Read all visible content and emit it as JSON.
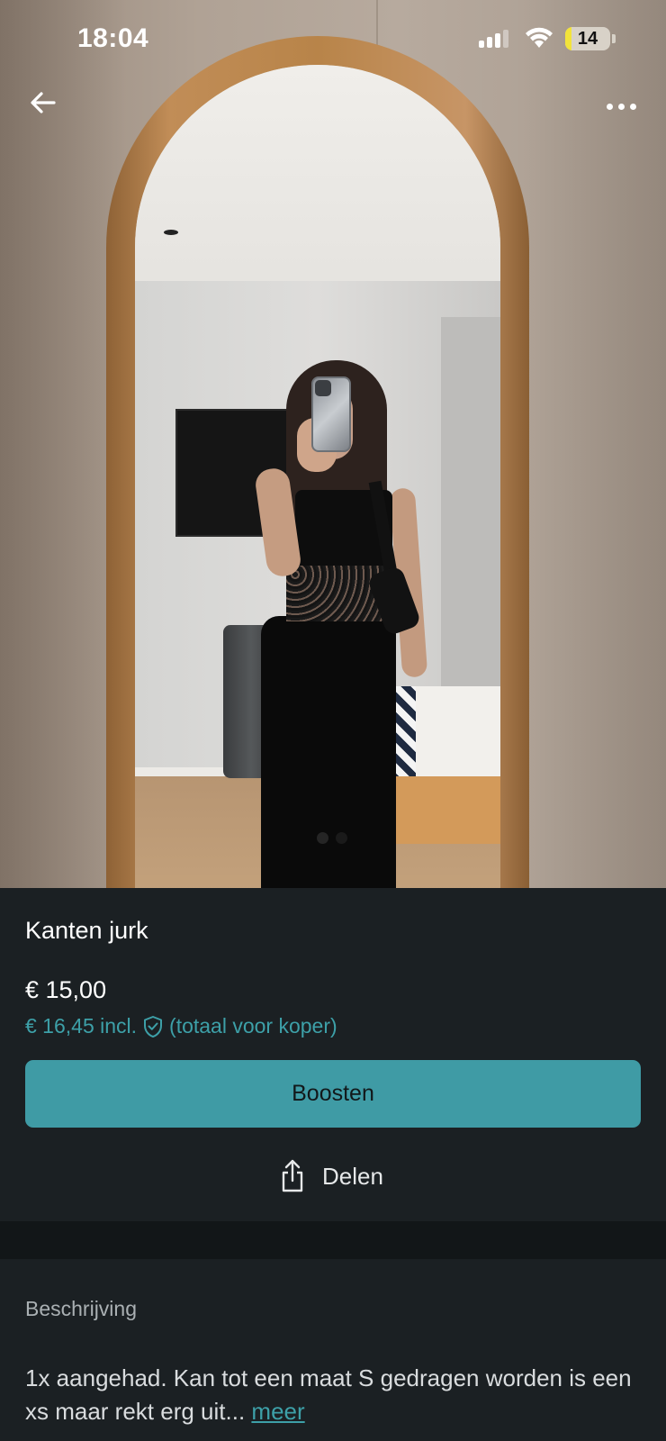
{
  "status_bar": {
    "time": "18:04",
    "battery": "14",
    "battery_level": 0.14,
    "icons": [
      "cellular-signal-icon",
      "wifi-icon",
      "battery-icon"
    ]
  },
  "header": {
    "back_icon": "arrow-left-icon",
    "more_icon": "more-horizontal-icon"
  },
  "gallery": {
    "image_count": 2,
    "current_index": 0
  },
  "listing": {
    "title": "Kanten jurk",
    "price": "€ 15,00",
    "price_incl": "€ 16,45 incl.",
    "price_incl_note": "(totaal voor koper)",
    "boost_label": "Boosten",
    "share_label": "Delen"
  },
  "description": {
    "label": "Beschrijving",
    "text": "1x aangehad. Kan tot een maat S gedragen worden is een xs maar rekt erg uit...",
    "more_label": "meer"
  },
  "colors": {
    "accent": "#3f9ba5",
    "accent_text": "#3da0a8",
    "background": "#1b2023"
  }
}
